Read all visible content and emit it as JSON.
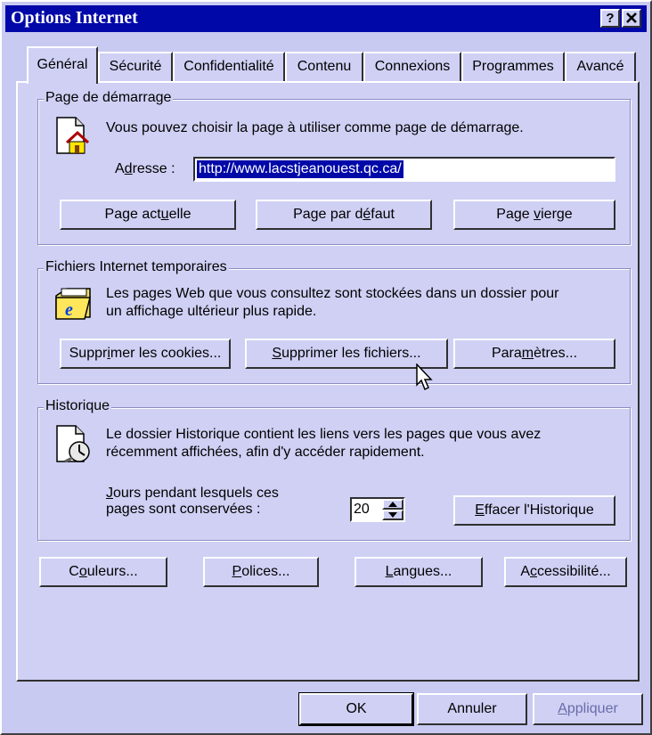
{
  "window": {
    "title": "Options Internet",
    "help_label": "?",
    "close_label": "✕"
  },
  "tabs": [
    {
      "label": "Général"
    },
    {
      "label": "Sécurité"
    },
    {
      "label": "Confidentialité"
    },
    {
      "label": "Contenu"
    },
    {
      "label": "Connexions"
    },
    {
      "label": "Programmes"
    },
    {
      "label": "Avancé"
    }
  ],
  "home": {
    "group_label": "Page de démarrage",
    "description": "Vous pouvez choisir la page à utiliser comme page de démarrage.",
    "address_label": "Adresse :",
    "address_value": "http://www.lacstjeanouest.qc.ca/",
    "buttons": {
      "current": "Page actuelle",
      "default": "Page par défaut",
      "blank": "Page vierge"
    }
  },
  "temp": {
    "group_label": "Fichiers Internet temporaires",
    "description_line1": "Les pages Web que vous consultez sont stockées dans un dossier pour",
    "description_line2": "un affichage ultérieur plus rapide.",
    "buttons": {
      "cookies": "Supprimer les cookies...",
      "files": "Supprimer les fichiers...",
      "settings": "Paramètres..."
    }
  },
  "history": {
    "group_label": "Historique",
    "description_line1": "Le dossier Historique contient les liens vers les pages que vous avez",
    "description_line2": "récemment affichées, afin d'y accéder rapidement.",
    "days_label_line1": "Jours pendant lesquels ces",
    "days_label_line2": "pages sont conservées :",
    "days_value": "20",
    "clear_button": "Effacer l'Historique"
  },
  "bottom_buttons": {
    "colors": "Couleurs...",
    "fonts": "Polices...",
    "languages": "Langues...",
    "accessibility": "Accessibilité..."
  },
  "dialog_buttons": {
    "ok": "OK",
    "cancel": "Annuler",
    "apply": "Appliquer"
  },
  "colors": {
    "title_bar": "#0008a8",
    "face": "#cfd0f4",
    "apply_disabled": "#6a6ca8"
  }
}
